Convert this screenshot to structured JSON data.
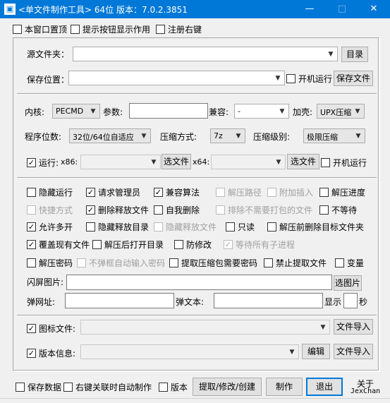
{
  "window": {
    "title": "<单文件制作工具> 64位 版本：7.0.2.3851",
    "minimize": "—",
    "maximize": "□",
    "close": "✕",
    "icon": "app-icon"
  },
  "top_options": {
    "stay_on_top": "本窗口置顶",
    "show_tooltips": "提示按钮显示作用",
    "register_context": "注册右键"
  },
  "source": {
    "label": "源文件夹：",
    "value": "",
    "dir_button": "目录"
  },
  "save": {
    "label": "保存位置：",
    "value": "",
    "startup_run": "开机运行",
    "save_button": "保存文件"
  },
  "core": {
    "kernel_label": "内核:",
    "kernel_value": "PECMD",
    "params_label": "参数:",
    "params_value": "",
    "compat_label": "兼容:",
    "compat_value": "-",
    "shell_label": "加壳:",
    "shell_value": "UPX压缩"
  },
  "bits": {
    "label": "程序位数:",
    "value": "32位/64位自适应",
    "compress_method_label": "压缩方式:",
    "compress_method_value": "7z",
    "compress_level_label": "压缩级别:",
    "compress_level_value": "极限压缩"
  },
  "run": {
    "label": "运行:",
    "x86_label": "x86:",
    "x86_value": "",
    "x86_button": "选文件",
    "x64_label": "x64:",
    "x64_value": "",
    "x64_button": "选文件",
    "startup_run": "开机运行"
  },
  "options": {
    "row1": [
      "隐藏运行",
      "请求管理员",
      "兼容算法",
      "解压路径",
      "附加插入",
      "解压进度"
    ],
    "row2": [
      "快捷方式",
      "删除释放文件",
      "自我删除",
      "排除不需要打包的文件",
      "不等待"
    ],
    "row3": [
      "允许多开",
      "隐藏释放目录",
      "隐藏释放文件",
      "只读",
      "解压前删除目标文件夹"
    ],
    "row4": [
      "覆盖现有文件",
      "解压后打开目录",
      "防修改",
      "等待所有子进程"
    ],
    "row5": [
      "解压密码",
      "不弹框自动输入密码",
      "提取压缩包需要密码",
      "禁止提取文件",
      "变量"
    ]
  },
  "splash": {
    "label": "闪屏图片:",
    "value": "",
    "button": "选图片"
  },
  "popup": {
    "url_label": "弹网址:",
    "url_value": "",
    "text_label": "弹文本:",
    "text_value": "",
    "show_label": "显示",
    "seconds_value": "",
    "seconds_unit": "秒"
  },
  "icon_file": {
    "label": "图标文件:",
    "value": "",
    "import_button": "文件导入"
  },
  "version_info": {
    "label": "版本信息:",
    "value": "",
    "edit_button": "编辑",
    "import_button": "文件导入"
  },
  "bottom": {
    "save_data": "保存数据",
    "ctx_auto": "右键关联时自动制作",
    "version": "版本",
    "extract_button": "提取/修改/创建",
    "make_button": "制作",
    "exit_button": "退出",
    "about_label": "关于",
    "author": "JexChan"
  },
  "colors": {
    "titlebar": "#0078d7",
    "window_bg": "#f0f0f0",
    "accent": "#0078d7"
  }
}
